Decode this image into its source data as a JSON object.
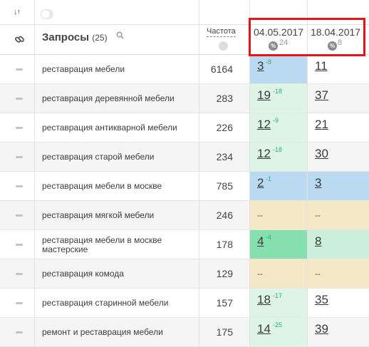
{
  "header": {
    "sort_icon": "↓↑",
    "queries_title": "Запросы",
    "queries_count": "(25)",
    "frequency_title": "Частота",
    "dates": [
      {
        "date": "04.05.2017",
        "pct_label": "%",
        "pct_value": "24"
      },
      {
        "date": "18.04.2017",
        "pct_label": "%",
        "pct_value": "8"
      }
    ]
  },
  "icons": {
    "sort": "sort-icon",
    "link": "link-icon",
    "search": "search-icon",
    "globe": "globe-icon"
  },
  "colors": {
    "highlight": "#e8121b",
    "blue": "#b9daf0",
    "green": "#ddf4e6",
    "dark_green": "#85dfae",
    "yellow": "#f5e8c4",
    "change": "#2bb673"
  },
  "rows": [
    {
      "query": "реставрация мебели",
      "freq": "6164",
      "p1": "3",
      "c1": "-8",
      "p2": "11"
    },
    {
      "query": "реставрация деревянной мебели",
      "freq": "283",
      "p1": "19",
      "c1": "-18",
      "p2": "37"
    },
    {
      "query": "реставрация антикварной мебели",
      "freq": "226",
      "p1": "12",
      "c1": "-9",
      "p2": "21"
    },
    {
      "query": "реставрация старой мебели",
      "freq": "234",
      "p1": "12",
      "c1": "-18",
      "p2": "30"
    },
    {
      "query": "реставрация мебели в москве",
      "freq": "785",
      "p1": "2",
      "c1": "-1",
      "p2": "3"
    },
    {
      "query": "реставрация мягкой мебели",
      "freq": "246",
      "p1": "--",
      "c1": "",
      "p2": "--"
    },
    {
      "query_line1": "реставрация мебели в москве",
      "query_line2": "мастерские",
      "freq": "178",
      "p1": "4",
      "c1": "-4",
      "p2": "8"
    },
    {
      "query": "реставрация комода",
      "freq": "129",
      "p1": "--",
      "c1": "",
      "p2": "--"
    },
    {
      "query": "реставрация старинной мебели",
      "freq": "157",
      "p1": "18",
      "c1": "-17",
      "p2": "35"
    },
    {
      "query": "ремонт и реставрация мебели",
      "freq": "175",
      "p1": "14",
      "c1": "-25",
      "p2": "39"
    }
  ]
}
